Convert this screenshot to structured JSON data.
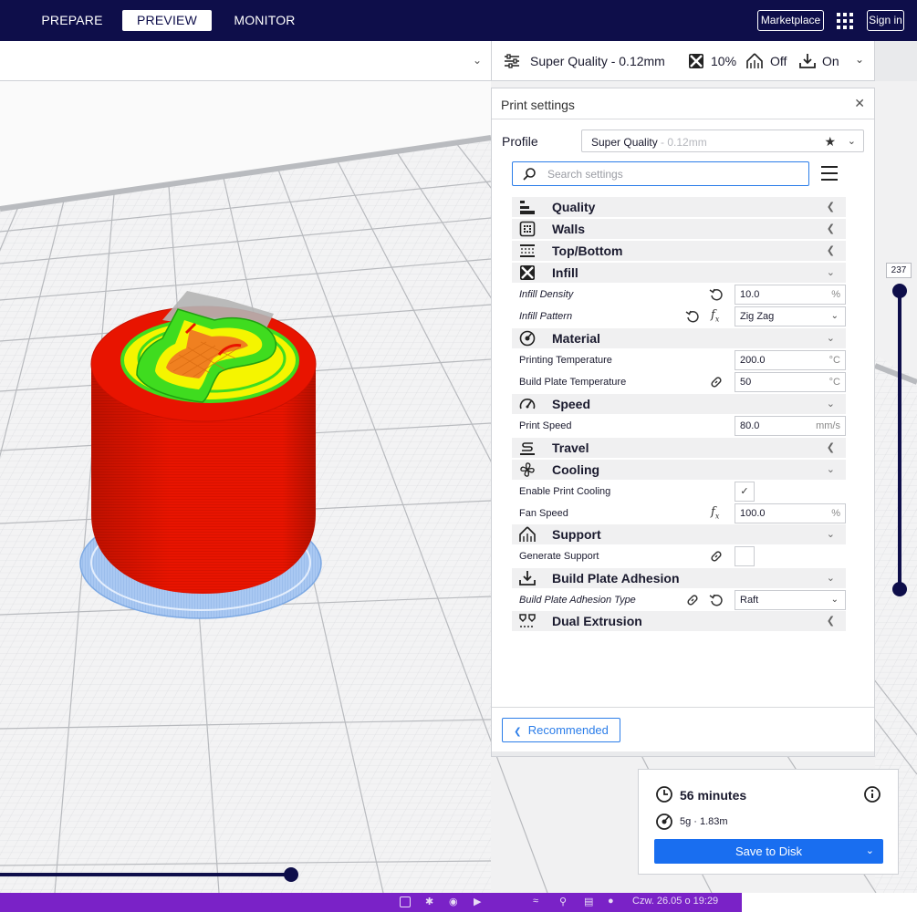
{
  "topbar": {
    "stages": [
      "PREPARE",
      "PREVIEW",
      "MONITOR"
    ],
    "active_stage": "PREVIEW",
    "marketplace_label": "Marketplace",
    "signin_label": "Sign in"
  },
  "print_setup": {
    "profile_summary": "Super Quality - 0.12mm",
    "infill_summary": "10%",
    "support_summary": "Off",
    "adhesion_summary": "On"
  },
  "print_settings": {
    "title": "Print settings",
    "profile_label": "Profile",
    "profile_name": "Super Quality",
    "profile_layer": " - 0.12mm",
    "search_placeholder": "Search settings",
    "categories": {
      "quality": "Quality",
      "walls": "Walls",
      "topbottom": "Top/Bottom",
      "infill": "Infill",
      "material": "Material",
      "speed": "Speed",
      "travel": "Travel",
      "cooling": "Cooling",
      "support": "Support",
      "adhesion": "Build Plate Adhesion",
      "dual": "Dual Extrusion"
    },
    "settings": {
      "infill_density": {
        "label": "Infill Density",
        "value": "10.0",
        "unit": "%"
      },
      "infill_pattern": {
        "label": "Infill Pattern",
        "value": "Zig Zag"
      },
      "print_temp": {
        "label": "Printing Temperature",
        "value": "200.0",
        "unit": "°C"
      },
      "bed_temp": {
        "label": "Build Plate Temperature",
        "value": "50",
        "unit": "°C"
      },
      "print_speed": {
        "label": "Print Speed",
        "value": "80.0",
        "unit": "mm/s"
      },
      "enable_cooling": {
        "label": "Enable Print Cooling",
        "checked": true
      },
      "fan_speed": {
        "label": "Fan Speed",
        "value": "100.0",
        "unit": "%"
      },
      "generate_support": {
        "label": "Generate Support",
        "checked": false
      },
      "adhesion_type": {
        "label": "Build Plate Adhesion Type",
        "value": "Raft"
      }
    },
    "recommended_label": "Recommended"
  },
  "layer_slider": {
    "max_layer": "237"
  },
  "output": {
    "time": "56 minutes",
    "material": "5g · 1.83m",
    "save_label": "Save to Disk"
  },
  "taskbar": {
    "datetime": "Czw. 26.05 o 19:29"
  },
  "colors": {
    "topbar": "#0e0e4a",
    "accent": "#196ef0",
    "model_wall": "#e81400",
    "model_infill_green": "#3fdc1f",
    "model_infill_yellow": "#f5f500",
    "model_top": "#f08020",
    "raft": "#8fb8ee",
    "taskbar": "#7a22c7"
  }
}
